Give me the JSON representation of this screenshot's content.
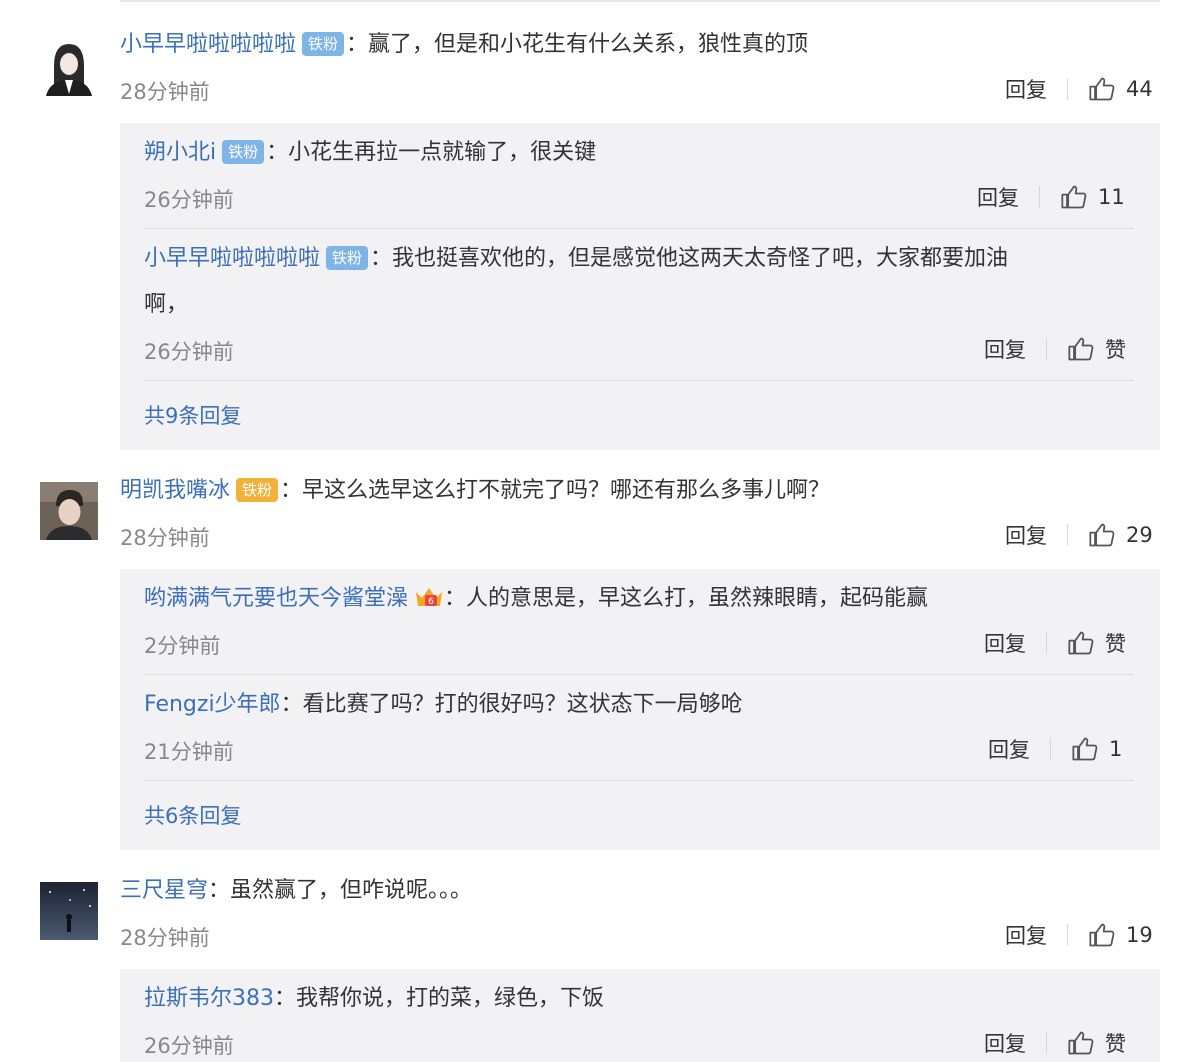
{
  "reply_label": "回复",
  "zan_label": "赞",
  "comments": [
    {
      "user": "小早早啦啦啦啦啦",
      "badge": "铁粉",
      "text": "：赢了，但是和小花生有什么关系，狼性真的顶",
      "time": "28分钟前",
      "likes": "44",
      "replies": [
        {
          "user": "朔小北i",
          "badge": "铁粉",
          "text": "：小花生再拉一点就输了，很关键",
          "time": "26分钟前",
          "likes": "11"
        },
        {
          "user": "小早早啦啦啦啦啦",
          "badge": "铁粉",
          "text": "：我也挺喜欢他的，但是感觉他这两天太奇怪了吧，大家都要加油",
          "text2": "啊，",
          "time": "26分钟前",
          "likes": "赞"
        }
      ],
      "more": "共9条回复"
    },
    {
      "user": "明凯我嘴冰",
      "badge": "铁粉",
      "text": "：早这么选早这么打不就完了吗？哪还有那么多事儿啊？",
      "time": "28分钟前",
      "likes": "29",
      "replies": [
        {
          "user": "哟满满气元要也天今酱堂澡",
          "text": "：人的意思是，早这么打，虽然辣眼睛，起码能赢",
          "time": "2分钟前",
          "likes": "赞"
        },
        {
          "user": "Fengzi少年郎",
          "text": "：看比赛了吗？打的很好吗？这状态下一局够呛",
          "time": "21分钟前",
          "likes": "1"
        }
      ],
      "more": "共6条回复"
    },
    {
      "user": "三尺星穹",
      "text": "：虽然赢了，但咋说呢。。。",
      "time": "28分钟前",
      "likes": "19",
      "replies": [
        {
          "user": "拉斯韦尔383",
          "text": "：我帮你说，打的菜，绿色，下饭",
          "time": "26分钟前",
          "likes": "赞"
        }
      ]
    }
  ]
}
